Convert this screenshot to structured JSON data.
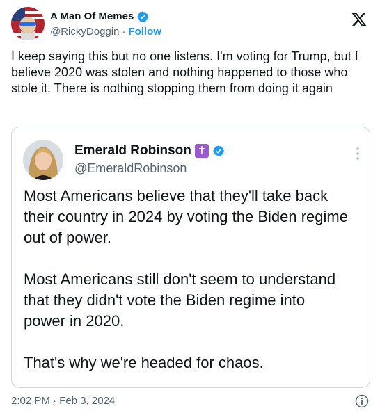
{
  "author": {
    "display_name": "A Man Of Memes",
    "handle": "@RickyDoggin",
    "separator": "·",
    "follow_label": "Follow"
  },
  "tweet": {
    "text": "I keep saying this but no one listens. I'm voting for Trump, but I believe 2020 was stolen and nothing happened to those who stole it. There is nothing stopping them from doing it again"
  },
  "quote": {
    "display_name": "Emerald Robinson",
    "badge": "✝",
    "handle": "@EmeraldRobinson",
    "paragraphs": [
      "Most Americans believe that they'll take back their country in 2024 by voting the Biden regime out of power.",
      "Most Americans still don't seem to understand that they didn't vote the Biden regime into power in 2020.",
      "That's why we're headed for chaos."
    ]
  },
  "footer": {
    "timestamp": "2:02 PM · Feb 3, 2024"
  },
  "colors": {
    "verified_blue": "#1d9bf0",
    "follow_blue": "#1d9bf0",
    "secondary_text": "#536471",
    "badge_purple": "#9b59d0",
    "border": "#cfd9de"
  },
  "icons": [
    "verified-badge-icon",
    "x-logo-icon",
    "cross-badge-icon",
    "more-options-icon",
    "info-icon"
  ]
}
